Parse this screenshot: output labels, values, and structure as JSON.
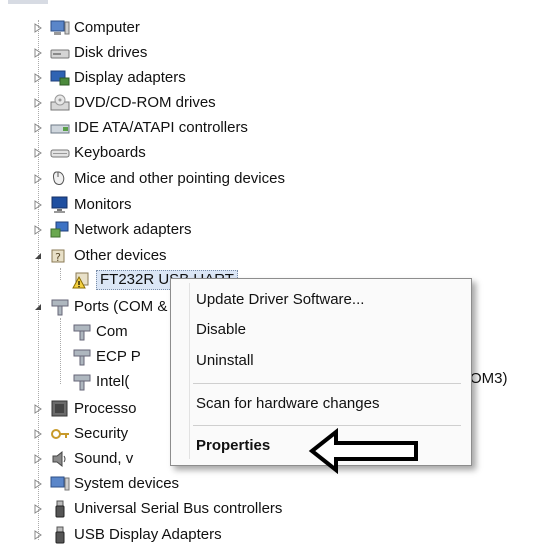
{
  "tree": {
    "items": [
      {
        "label": "Computer",
        "icon": "computer-icon"
      },
      {
        "label": "Disk drives",
        "icon": "disk-drive-icon"
      },
      {
        "label": "Display adapters",
        "icon": "display-adapter-icon"
      },
      {
        "label": "DVD/CD-ROM drives",
        "icon": "dvd-drive-icon"
      },
      {
        "label": "IDE ATA/ATAPI controllers",
        "icon": "ide-controller-icon"
      },
      {
        "label": "Keyboards",
        "icon": "keyboard-icon"
      },
      {
        "label": "Mice and other pointing devices",
        "icon": "mouse-icon"
      },
      {
        "label": "Monitors",
        "icon": "monitor-icon"
      },
      {
        "label": "Network adapters",
        "icon": "network-adapter-icon"
      },
      {
        "label": "Other devices",
        "icon": "other-devices-icon"
      },
      {
        "label": "FT232R USB UART",
        "icon": "warning-device-icon"
      },
      {
        "label": "Ports (COM & LPT)",
        "icon": "port-icon"
      },
      {
        "label": "Com",
        "icon": "port-icon"
      },
      {
        "label": "ECP P",
        "icon": "port-icon"
      },
      {
        "label": "Intel(",
        "icon": "port-icon"
      },
      {
        "label": "Processo",
        "icon": "processor-icon"
      },
      {
        "label": "Security",
        "icon": "security-icon"
      },
      {
        "label": "Sound, v",
        "icon": "sound-icon"
      },
      {
        "label": "System devices",
        "icon": "system-devices-icon"
      },
      {
        "label": "Universal Serial Bus controllers",
        "icon": "usb-icon"
      },
      {
        "label": "USB Display Adapters",
        "icon": "usb-icon"
      }
    ],
    "intel_trailing": "OM3)"
  },
  "context_menu": {
    "items": [
      "Update Driver Software...",
      "Disable",
      "Uninstall",
      "Scan for hardware changes",
      "Properties"
    ]
  },
  "colors": {
    "selection": "#dbe6f6",
    "menu_bg": "#fafafa",
    "arrow": "#000000"
  }
}
